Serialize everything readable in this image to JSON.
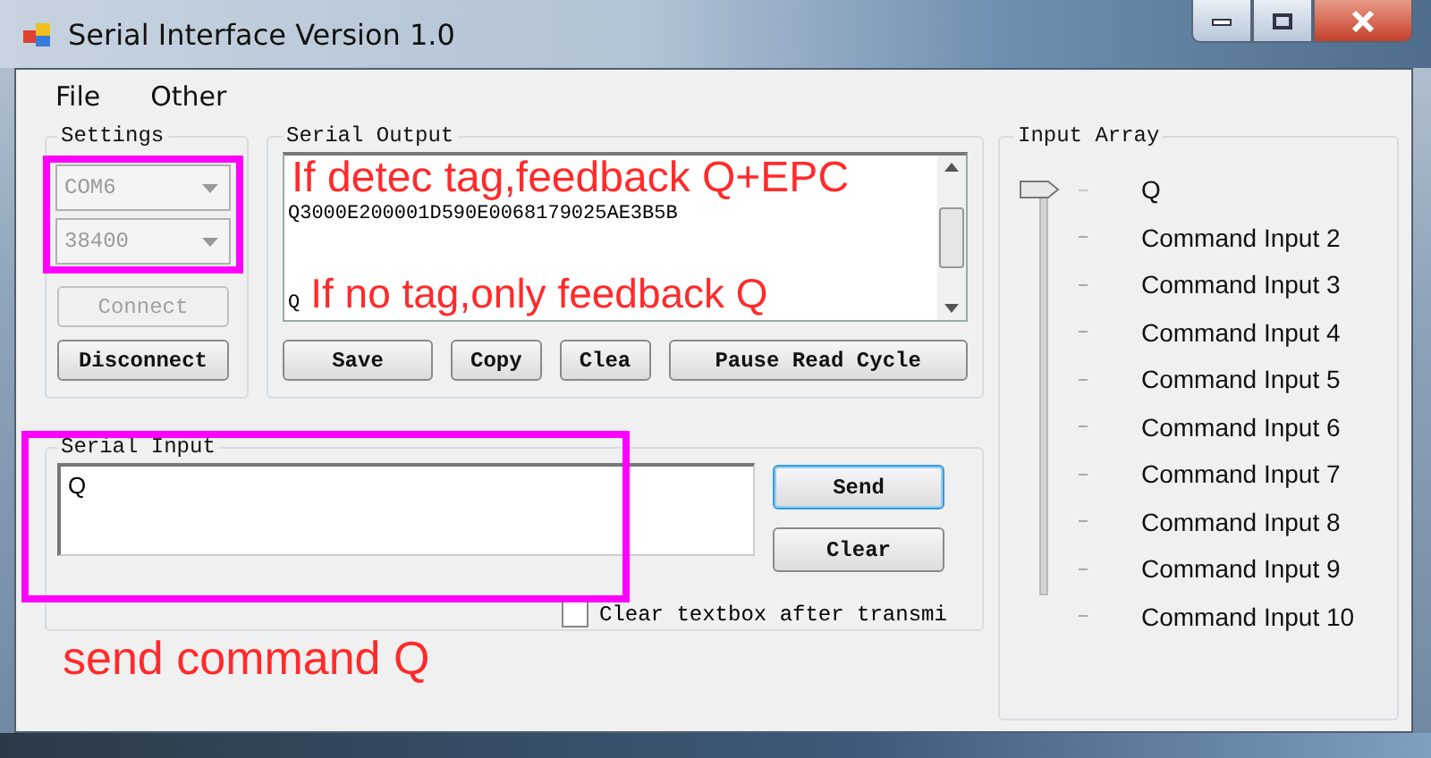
{
  "window": {
    "title": "Serial Interface Version 1.0"
  },
  "menu": [
    {
      "label": "File"
    },
    {
      "label": "Other"
    }
  ],
  "settings": {
    "title": "Settings",
    "port": {
      "value": "COM6",
      "disabled": true
    },
    "baud": {
      "value": "38400",
      "disabled": true
    },
    "connect": {
      "label": "Connect",
      "disabled": true
    },
    "disconnect": {
      "label": "Disconnect",
      "disabled": false
    }
  },
  "serial_output": {
    "title": "Serial Output",
    "lines": [
      "Q3000E200001D590E0068179025AE3B5B",
      "Q"
    ],
    "buttons": [
      "Save",
      "Copy",
      "Clea",
      "Pause Read Cycle"
    ],
    "annotations": [
      "If detec tag,feedback Q+EPC",
      "If no tag,only feedback Q"
    ]
  },
  "serial_input": {
    "title": "Serial Input",
    "value": "Q",
    "buttons": [
      {
        "label": "Send",
        "default": true
      },
      {
        "label": "Clear",
        "default": false
      }
    ],
    "clear_after_transmit": {
      "label": "Clear textbox after transmi",
      "checked": false
    },
    "annotation": "send command Q"
  },
  "input_array": {
    "title": "Input Array",
    "items": [
      {
        "label": "Q",
        "selected": true
      },
      {
        "label": "Command Input 2",
        "selected": false
      },
      {
        "label": "Command Input 3",
        "selected": false
      },
      {
        "label": "Command Input 4",
        "selected": false
      },
      {
        "label": "Command Input 5",
        "selected": false
      },
      {
        "label": "Command Input 6",
        "selected": false
      },
      {
        "label": "Command Input 7",
        "selected": false
      },
      {
        "label": "Command Input 8",
        "selected": false
      },
      {
        "label": "Command Input 9",
        "selected": false
      },
      {
        "label": "Command Input 10",
        "selected": false
      }
    ]
  }
}
